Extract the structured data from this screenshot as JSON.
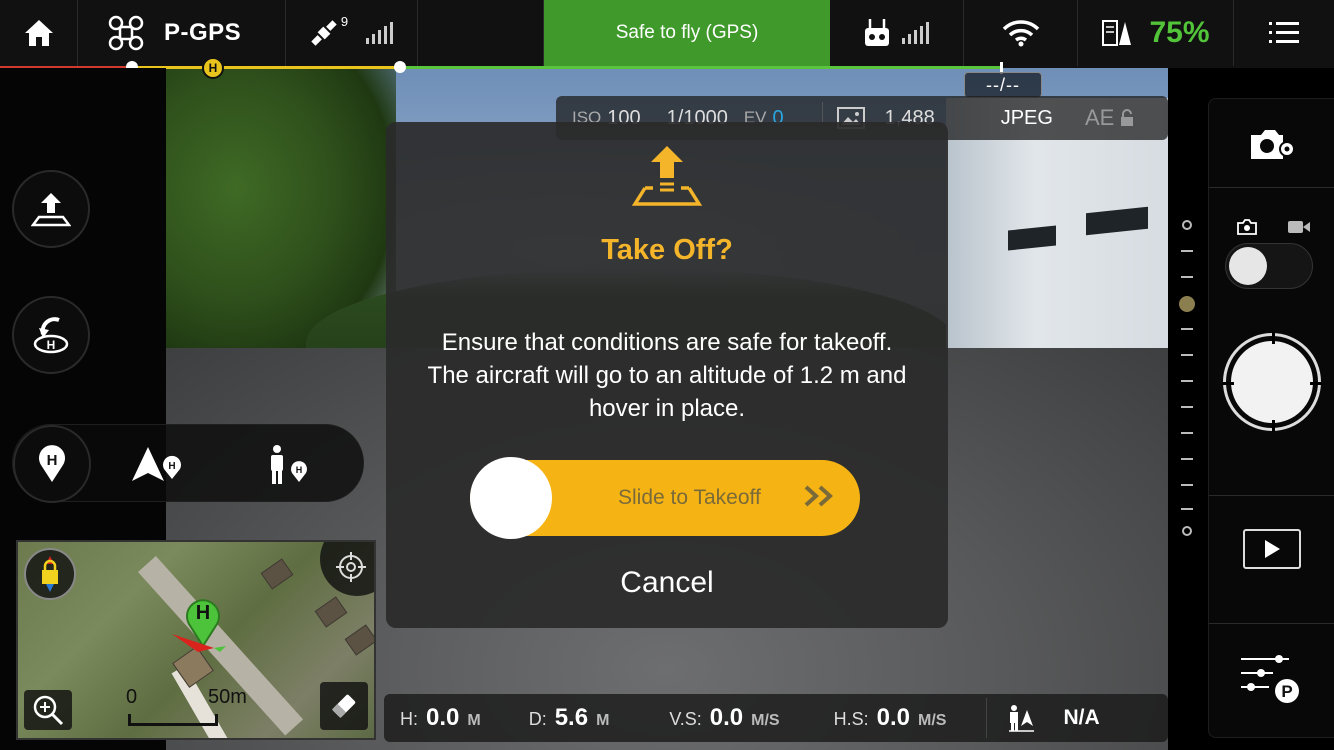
{
  "top_bar": {
    "flight_mode": "P-GPS",
    "satellite_count": "9",
    "status_banner": "Safe to fly (GPS)",
    "battery_percent": "75%",
    "home_marker": "H",
    "flight_timer": "--/--",
    "colors": {
      "banner": "#3f9a2b",
      "battery": "#52c43a",
      "progress_red": "#d23a2f",
      "progress_yellow": "#e9c41c",
      "progress_green": "#5ac43c"
    }
  },
  "camera_params": {
    "iso_label": "ISO",
    "iso_value": "100",
    "shutter": "1/1000",
    "ev_label": "EV",
    "ev_value": "0",
    "remaining_shots": "1,488",
    "format": "JPEG",
    "ae_label": "AE"
  },
  "left_controls": {
    "takeoff_icon": "takeoff-icon",
    "rth_icon": "return-home-icon",
    "home_point_icon": "home-point-icon",
    "map_home_marker": "H"
  },
  "minimap": {
    "scale_start": "0",
    "scale_end": "50m"
  },
  "dialog": {
    "title": "Take Off?",
    "message": "Ensure that conditions are safe for takeoff. The aircraft will go to an altitude of 1.2 m and hover in place.",
    "slider_label": "Slide to Takeoff",
    "cancel_label": "Cancel",
    "accent": "#f5b414"
  },
  "telemetry": {
    "h_label": "H:",
    "h_value": "0.0",
    "h_unit": "M",
    "d_label": "D:",
    "d_value": "5.6",
    "d_unit": "M",
    "vs_label": "V.S:",
    "vs_value": "0.0",
    "vs_unit": "M/S",
    "hs_label": "H.S:",
    "hs_value": "0.0",
    "hs_unit": "M/S",
    "vps_value": "N/A"
  }
}
